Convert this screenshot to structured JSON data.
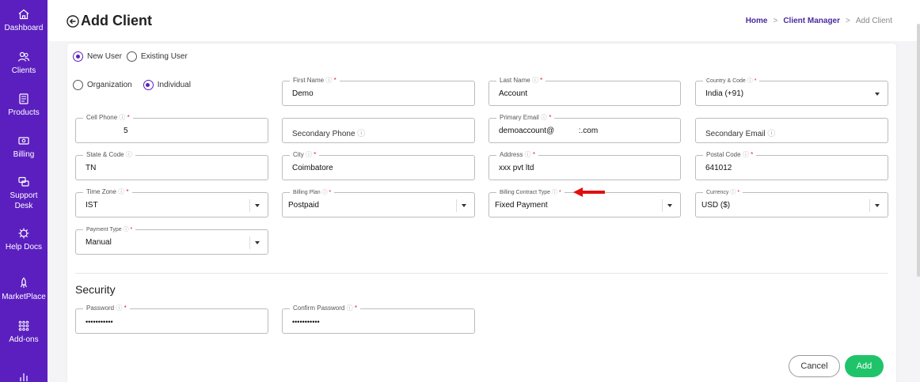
{
  "sidebar": {
    "items": [
      {
        "label": "Dashboard",
        "icon": "home-icon"
      },
      {
        "label": "Clients",
        "icon": "users-icon"
      },
      {
        "label": "Products",
        "icon": "products-icon"
      },
      {
        "label": "Billing",
        "icon": "billing-icon"
      },
      {
        "label": "Support Desk",
        "icon": "support-icon"
      },
      {
        "label": "Help Docs",
        "icon": "help-docs-icon"
      },
      {
        "label": "MarketPlace",
        "icon": "marketplace-icon"
      },
      {
        "label": "Add-ons",
        "icon": "addons-icon"
      }
    ]
  },
  "header": {
    "title": "Add Client",
    "breadcrumb": [
      "Home",
      "Client Manager",
      "Add Client"
    ]
  },
  "user_type": {
    "new_user": "New User",
    "existing_user": "Existing User",
    "selected": "New User"
  },
  "client_type": {
    "organization": "Organization",
    "individual": "Individual",
    "selected": "Individual"
  },
  "fields": {
    "first_name": {
      "label": "First Name",
      "value": "Demo"
    },
    "last_name": {
      "label": "Last Name",
      "value": "Account"
    },
    "country_code": {
      "label": "Country & Code",
      "value": "India (+91)"
    },
    "cell_phone": {
      "label": "Cell Phone",
      "value": "5"
    },
    "secondary_phone": {
      "label": "Secondary Phone"
    },
    "primary_email": {
      "label": "Primary Email",
      "value": "demoaccount@           :.com"
    },
    "secondary_email": {
      "label": "Secondary Email"
    },
    "state_code": {
      "label": "State & Code",
      "value": "TN"
    },
    "city": {
      "label": "City",
      "value": "Coimbatore"
    },
    "address": {
      "label": "Address",
      "value": "xxx pvt ltd"
    },
    "postal_code": {
      "label": "Postal Code",
      "value": "641012"
    },
    "time_zone": {
      "label": "Time Zone",
      "value": "IST"
    },
    "billing_plan": {
      "label": "Billing Plan",
      "value": "Postpaid"
    },
    "billing_contract_type": {
      "label": "Billing Contract Type",
      "value": "Fixed Payment"
    },
    "currency": {
      "label": "Currency",
      "value": "USD ($)"
    },
    "payment_type": {
      "label": "Payment Type",
      "value": "Manual"
    }
  },
  "security": {
    "title": "Security",
    "password": {
      "label": "Password",
      "value": "•••••••••••"
    },
    "confirm_password": {
      "label": "Confirm Password",
      "value": "•••••••••••"
    }
  },
  "actions": {
    "cancel": "Cancel",
    "add": "Add"
  },
  "colors": {
    "brand": "#5b1fbf",
    "add_button": "#1fc46a",
    "required": "#e02020",
    "arrow": "#e01010"
  }
}
